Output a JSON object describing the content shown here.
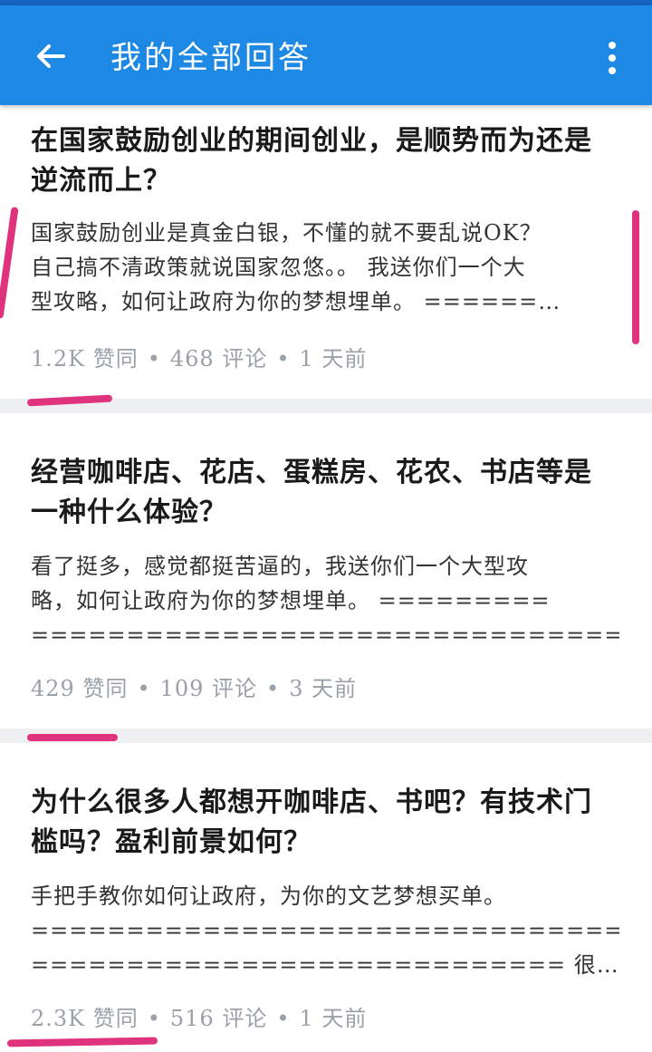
{
  "appbar": {
    "title": "我的全部回答",
    "back_icon": "arrow-back-icon",
    "menu_icon": "more-vert-icon",
    "color": "#1e88e5"
  },
  "answers": [
    {
      "title_lines": [
        "在国家鼓励创业的期间创业，是顺势而为还是",
        "逆流而上？"
      ],
      "excerpt_lines": [
        "国家鼓励创业是真金白银，不懂的就不要乱说OK？",
        "自己搞不清政策就说国家忽悠。。 我送你们一个大",
        "型攻略，如何让政府为你的梦想埋单。 ======…"
      ],
      "likes": "1.2K 赞同",
      "comments": "468 评论",
      "time": "1 天前"
    },
    {
      "title_lines": [
        "经营咖啡店、花店、蛋糕房、花农、书店等是",
        "一种什么体验？"
      ],
      "excerpt_lines": [
        "看了挺多，感觉都挺苦逼的，我送你们一个大型攻",
        "略，如何让政府为你的梦想埋单。 =========",
        "===============================…"
      ],
      "likes": "429 赞同",
      "comments": "109 评论",
      "time": "3 天前"
    },
    {
      "title_lines": [
        "为什么很多人都想开咖啡店、书吧？有技术门",
        "槛吗？盈利前景如何？"
      ],
      "excerpt_lines": [
        "手把手教你如何让政府，为你的文艺梦想买单。",
        "================================",
        "============================ 很…"
      ],
      "likes": "2.3K 赞同",
      "comments": "516 评论",
      "time": "1 天前"
    }
  ],
  "meta_separator": "•",
  "annotation_color": "#e0337e"
}
